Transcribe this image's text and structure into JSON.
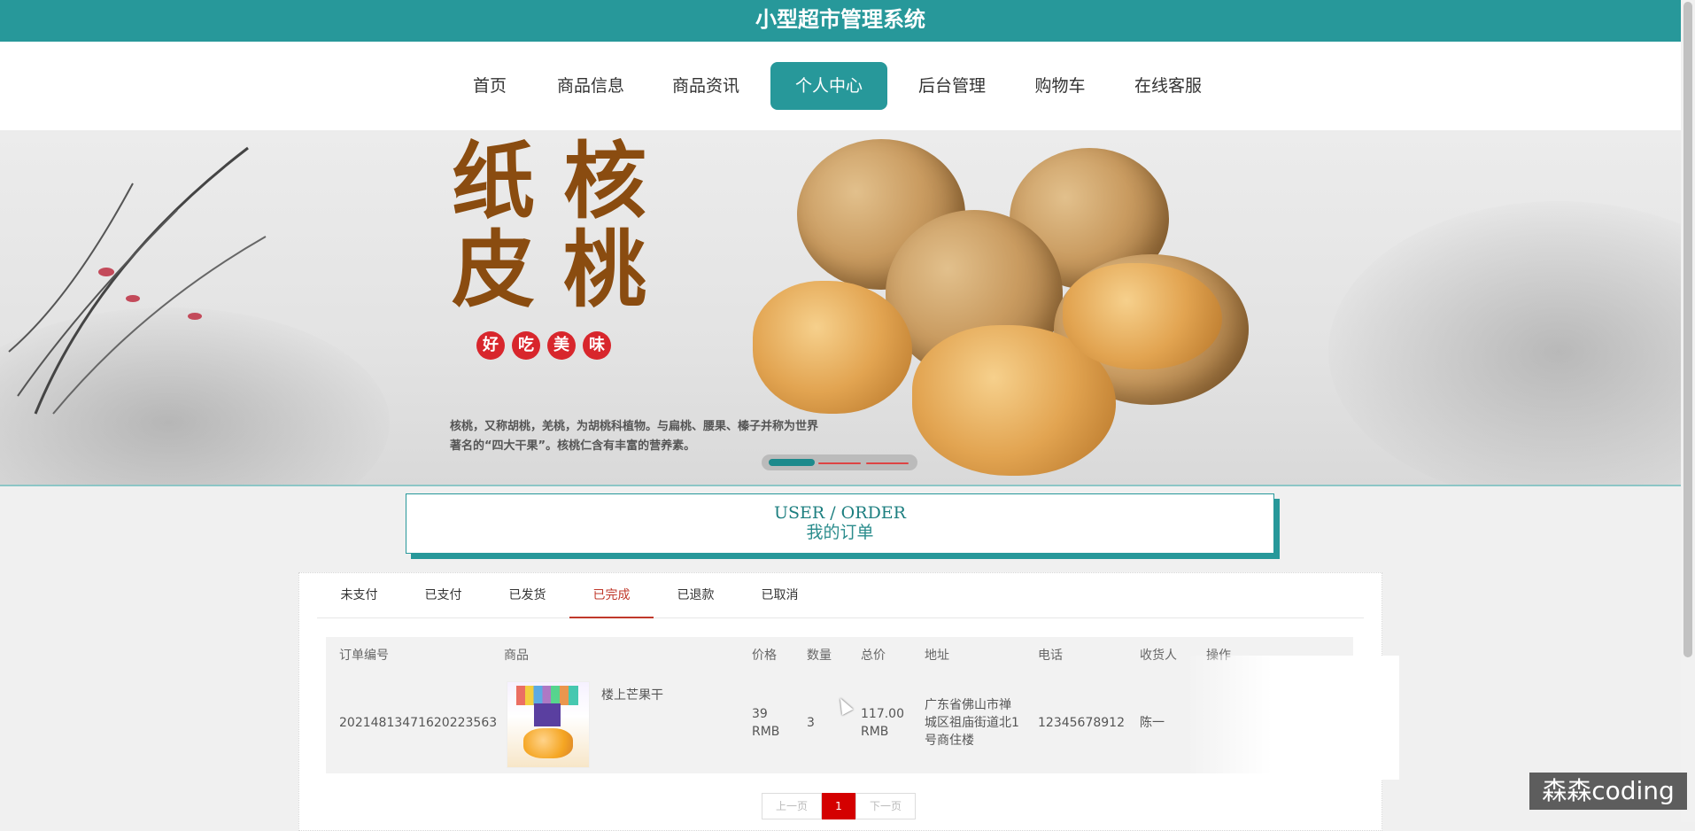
{
  "site_title": "小型超市管理系统",
  "nav": {
    "items": [
      {
        "label": "首页"
      },
      {
        "label": "商品信息"
      },
      {
        "label": "商品资讯"
      },
      {
        "label": "个人中心"
      },
      {
        "label": "后台管理"
      },
      {
        "label": "购物车"
      },
      {
        "label": "在线客服"
      }
    ],
    "active_index": 3
  },
  "banner": {
    "title_chars": [
      "纸",
      "核",
      "皮",
      "桃"
    ],
    "badges": [
      "好",
      "吃",
      "美",
      "味"
    ],
    "description": "核桃，又称胡桃，羌桃，为胡桃科植物。与扁桃、腰果、榛子并称为世界著名的“四大干果”。核桃仁含有丰富的营养素。",
    "slide_count": 3,
    "active_slide": 1
  },
  "section": {
    "title_en": "USER / ORDER",
    "title_cn": "我的订单"
  },
  "tabs": [
    {
      "label": "未支付"
    },
    {
      "label": "已支付"
    },
    {
      "label": "已发货"
    },
    {
      "label": "已完成"
    },
    {
      "label": "已退款"
    },
    {
      "label": "已取消"
    }
  ],
  "active_tab_index": 3,
  "table": {
    "headers": [
      "订单编号",
      "商品",
      "价格",
      "数量",
      "总价",
      "地址",
      "电话",
      "收货人",
      "操作"
    ],
    "rows": [
      {
        "order_no": "20214813471620223563",
        "product_name": "楼上芒果干",
        "price": "39 RMB",
        "quantity": "3",
        "total": "117.00 RMB",
        "address": "广东省佛山市禅城区祖庙街道北1号商住楼",
        "phone": "12345678912",
        "receiver": "陈一"
      }
    ]
  },
  "pagination": {
    "prev": "上一页",
    "current": "1",
    "next": "下一页"
  },
  "watermark": "森森coding",
  "colors": {
    "primary": "#27989a",
    "active_tab": "#c0392b",
    "page_current": "#d40000"
  }
}
